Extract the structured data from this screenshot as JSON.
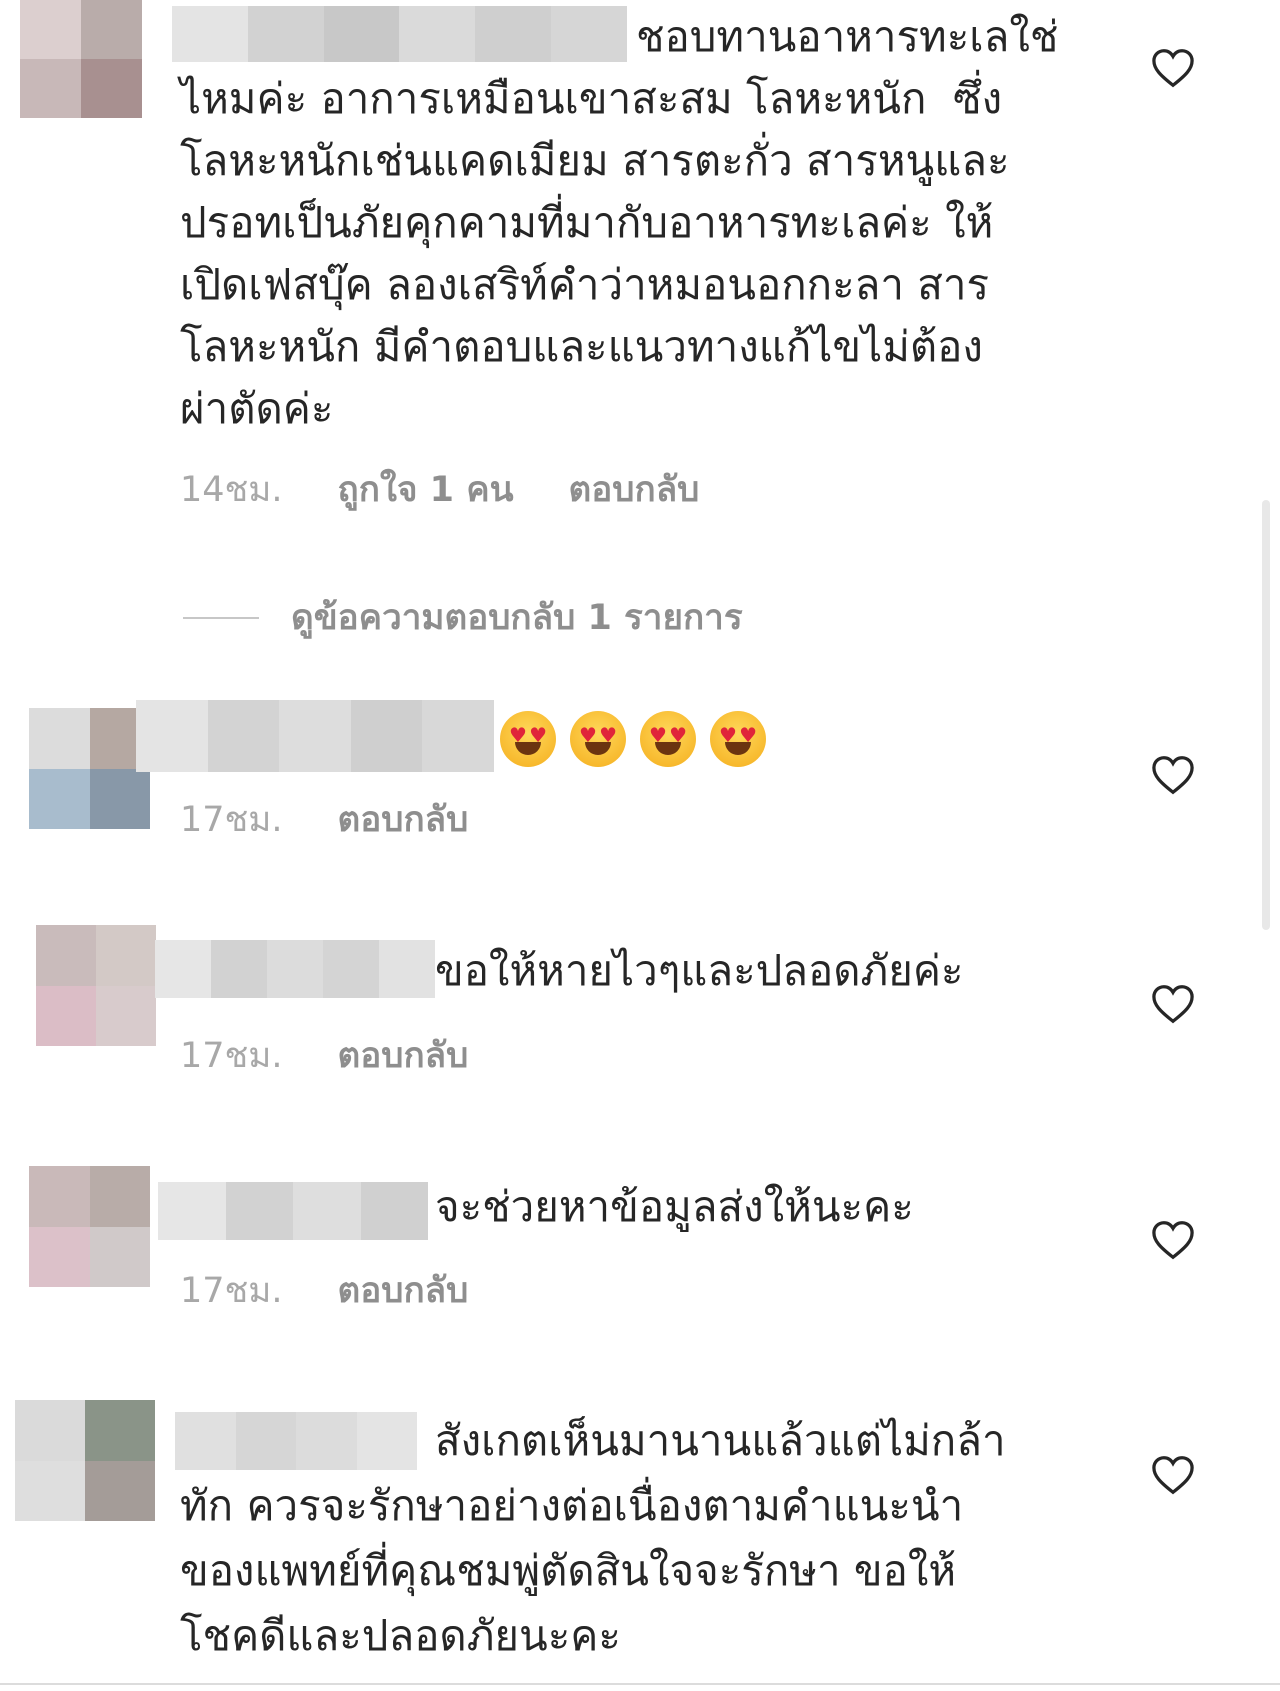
{
  "comments": [
    {
      "lines": [
        "ชอบทานอาหารทะเลใช่",
        "ไหมค่ะ อาการเหมือนเขาสะสม โลหะหนัก  ซึ่ง",
        "โลหะหนักเช่นแคดเมียม สารตะกั่ว สารหนูและ",
        "ปรอทเป็นภัยคุกคามที่มากับอาหารทะเลค่ะ ให้",
        "เปิดเฟสบุ๊ค ลองเสริท์คำว่าหมอนอกกะลา สาร",
        "โลหะหนัก มีคำตอบและแนวทางแก้ไขไม่ต้อง",
        "ผ่าตัดค่ะ"
      ],
      "time": "14ชม.",
      "likes": "ถูกใจ 1 คน",
      "reply": "ตอบกลับ",
      "view_replies": "ดูข้อความตอบกลับ 1 รายการ"
    },
    {
      "emoji": [
        "heart-eyes-emoji",
        "heart-eyes-emoji",
        "heart-eyes-emoji",
        "heart-eyes-emoji"
      ],
      "time": "17ชม.",
      "reply": "ตอบกลับ"
    },
    {
      "lines": [
        "ขอให้หายไวๆและปลอดภัยค่ะ"
      ],
      "time": "17ชม.",
      "reply": "ตอบกลับ"
    },
    {
      "lines": [
        "จะช่วยหาข้อมูลส่งให้นะคะ"
      ],
      "time": "17ชม.",
      "reply": "ตอบกลับ"
    },
    {
      "lines": [
        "สังเกตเห็นมานานแล้วแต่ไม่กล้า",
        "ทัก ควรจะรักษาอย่างต่อเนื่องตามคำแนะนำ",
        "ของแพทย์ที่คุณชมพู่ตัดสินใจจะรักษา ขอให้",
        "โชคดีและปลอดภัยนะคะ"
      ]
    }
  ],
  "icons": {
    "like": "heart-outline-icon"
  },
  "colors": {
    "text": "#262626",
    "meta": "#8e8e8e",
    "heart_stroke": "#262626"
  }
}
